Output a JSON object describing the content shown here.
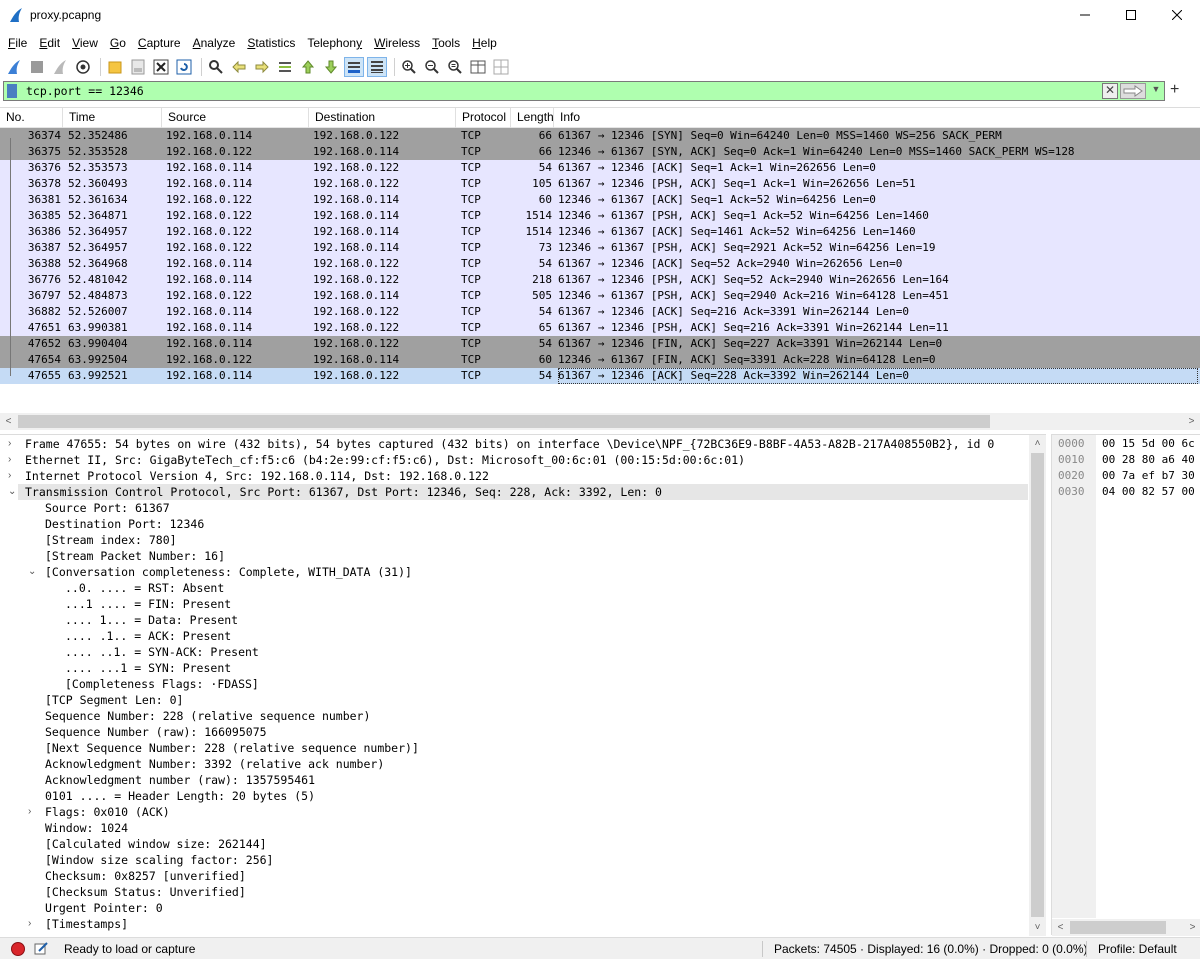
{
  "window": {
    "title": "proxy.pcapng"
  },
  "menu": [
    {
      "pre": "",
      "u": "F",
      "post": "ile"
    },
    {
      "pre": "",
      "u": "E",
      "post": "dit"
    },
    {
      "pre": "",
      "u": "V",
      "post": "iew"
    },
    {
      "pre": "",
      "u": "G",
      "post": "o"
    },
    {
      "pre": "",
      "u": "C",
      "post": "apture"
    },
    {
      "pre": "",
      "u": "A",
      "post": "nalyze"
    },
    {
      "pre": "",
      "u": "S",
      "post": "tatistics"
    },
    {
      "pre": "Telephon",
      "u": "y",
      "post": ""
    },
    {
      "pre": "",
      "u": "W",
      "post": "ireless"
    },
    {
      "pre": "",
      "u": "T",
      "post": "ools"
    },
    {
      "pre": "",
      "u": "H",
      "post": "elp"
    }
  ],
  "filter": {
    "text": "tcp.port == 12346",
    "plus": "+"
  },
  "packet_list": {
    "columns": [
      "No.",
      "Time",
      "Source",
      "Destination",
      "Protocol",
      "Length",
      "Info"
    ],
    "rows": [
      {
        "no": "36374",
        "time": "52.352486",
        "src": "192.168.0.114",
        "dst": "192.168.0.122",
        "proto": "TCP",
        "len": "66",
        "info": "61367 → 12346 [SYN] Seq=0 Win=64240 Len=0 MSS=1460 WS=256 SACK_PERM",
        "style": "dark"
      },
      {
        "no": "36375",
        "time": "52.353528",
        "src": "192.168.0.122",
        "dst": "192.168.0.114",
        "proto": "TCP",
        "len": "66",
        "info": "12346 → 61367 [SYN, ACK] Seq=0 Ack=1 Win=64240 Len=0 MSS=1460 SACK_PERM WS=128",
        "style": "dark"
      },
      {
        "no": "36376",
        "time": "52.353573",
        "src": "192.168.0.114",
        "dst": "192.168.0.122",
        "proto": "TCP",
        "len": "54",
        "info": "61367 → 12346 [ACK] Seq=1 Ack=1 Win=262656 Len=0",
        "style": "normal"
      },
      {
        "no": "36378",
        "time": "52.360493",
        "src": "192.168.0.114",
        "dst": "192.168.0.122",
        "proto": "TCP",
        "len": "105",
        "info": "61367 → 12346 [PSH, ACK] Seq=1 Ack=1 Win=262656 Len=51",
        "style": "normal"
      },
      {
        "no": "36381",
        "time": "52.361634",
        "src": "192.168.0.122",
        "dst": "192.168.0.114",
        "proto": "TCP",
        "len": "60",
        "info": "12346 → 61367 [ACK] Seq=1 Ack=52 Win=64256 Len=0",
        "style": "normal"
      },
      {
        "no": "36385",
        "time": "52.364871",
        "src": "192.168.0.122",
        "dst": "192.168.0.114",
        "proto": "TCP",
        "len": "1514",
        "info": "12346 → 61367 [PSH, ACK] Seq=1 Ack=52 Win=64256 Len=1460",
        "style": "normal"
      },
      {
        "no": "36386",
        "time": "52.364957",
        "src": "192.168.0.122",
        "dst": "192.168.0.114",
        "proto": "TCP",
        "len": "1514",
        "info": "12346 → 61367 [ACK] Seq=1461 Ack=52 Win=64256 Len=1460",
        "style": "normal"
      },
      {
        "no": "36387",
        "time": "52.364957",
        "src": "192.168.0.122",
        "dst": "192.168.0.114",
        "proto": "TCP",
        "len": "73",
        "info": "12346 → 61367 [PSH, ACK] Seq=2921 Ack=52 Win=64256 Len=19",
        "style": "normal"
      },
      {
        "no": "36388",
        "time": "52.364968",
        "src": "192.168.0.114",
        "dst": "192.168.0.122",
        "proto": "TCP",
        "len": "54",
        "info": "61367 → 12346 [ACK] Seq=52 Ack=2940 Win=262656 Len=0",
        "style": "normal"
      },
      {
        "no": "36776",
        "time": "52.481042",
        "src": "192.168.0.114",
        "dst": "192.168.0.122",
        "proto": "TCP",
        "len": "218",
        "info": "61367 → 12346 [PSH, ACK] Seq=52 Ack=2940 Win=262656 Len=164",
        "style": "normal"
      },
      {
        "no": "36797",
        "time": "52.484873",
        "src": "192.168.0.122",
        "dst": "192.168.0.114",
        "proto": "TCP",
        "len": "505",
        "info": "12346 → 61367 [PSH, ACK] Seq=2940 Ack=216 Win=64128 Len=451",
        "style": "normal"
      },
      {
        "no": "36882",
        "time": "52.526007",
        "src": "192.168.0.114",
        "dst": "192.168.0.122",
        "proto": "TCP",
        "len": "54",
        "info": "61367 → 12346 [ACK] Seq=216 Ack=3391 Win=262144 Len=0",
        "style": "normal"
      },
      {
        "no": "47651",
        "time": "63.990381",
        "src": "192.168.0.114",
        "dst": "192.168.0.122",
        "proto": "TCP",
        "len": "65",
        "info": "61367 → 12346 [PSH, ACK] Seq=216 Ack=3391 Win=262144 Len=11",
        "style": "normal"
      },
      {
        "no": "47652",
        "time": "63.990404",
        "src": "192.168.0.114",
        "dst": "192.168.0.122",
        "proto": "TCP",
        "len": "54",
        "info": "61367 → 12346 [FIN, ACK] Seq=227 Ack=3391 Win=262144 Len=0",
        "style": "dark"
      },
      {
        "no": "47654",
        "time": "63.992504",
        "src": "192.168.0.122",
        "dst": "192.168.0.114",
        "proto": "TCP",
        "len": "60",
        "info": "12346 → 61367 [FIN, ACK] Seq=3391 Ack=228 Win=64128 Len=0",
        "style": "dark"
      },
      {
        "no": "47655",
        "time": "63.992521",
        "src": "192.168.0.114",
        "dst": "192.168.0.122",
        "proto": "TCP",
        "len": "54",
        "info": "61367 → 12346 [ACK] Seq=228 Ack=3392 Win=262144 Len=0",
        "style": "selected"
      }
    ]
  },
  "details": [
    {
      "indent": 0,
      "twisty": "›",
      "text": "Frame 47655: 54 bytes on wire (432 bits), 54 bytes captured (432 bits) on interface \\Device\\NPF_{72BC36E9-B8BF-4A53-A82B-217A408550B2}, id 0"
    },
    {
      "indent": 0,
      "twisty": "›",
      "text": "Ethernet II, Src: GigaByteTech_cf:f5:c6 (b4:2e:99:cf:f5:c6), Dst: Microsoft_00:6c:01 (00:15:5d:00:6c:01)"
    },
    {
      "indent": 0,
      "twisty": "›",
      "text": "Internet Protocol Version 4, Src: 192.168.0.114, Dst: 192.168.0.122"
    },
    {
      "indent": 0,
      "twisty": "⌄",
      "text": "Transmission Control Protocol, Src Port: 61367, Dst Port: 12346, Seq: 228, Ack: 3392, Len: 0",
      "hl": true
    },
    {
      "indent": 1,
      "twisty": "",
      "text": "Source Port: 61367"
    },
    {
      "indent": 1,
      "twisty": "",
      "text": "Destination Port: 12346"
    },
    {
      "indent": 1,
      "twisty": "",
      "text": "[Stream index: 780]"
    },
    {
      "indent": 1,
      "twisty": "",
      "text": "[Stream Packet Number: 16]"
    },
    {
      "indent": 1,
      "twisty": "⌄",
      "text": "[Conversation completeness: Complete, WITH_DATA (31)]"
    },
    {
      "indent": 2,
      "twisty": "",
      "text": "..0. .... = RST: Absent"
    },
    {
      "indent": 2,
      "twisty": "",
      "text": "...1 .... = FIN: Present"
    },
    {
      "indent": 2,
      "twisty": "",
      "text": ".... 1... = Data: Present"
    },
    {
      "indent": 2,
      "twisty": "",
      "text": ".... .1.. = ACK: Present"
    },
    {
      "indent": 2,
      "twisty": "",
      "text": ".... ..1. = SYN-ACK: Present"
    },
    {
      "indent": 2,
      "twisty": "",
      "text": ".... ...1 = SYN: Present"
    },
    {
      "indent": 2,
      "twisty": "",
      "text": "[Completeness Flags: ·FDASS]"
    },
    {
      "indent": 1,
      "twisty": "",
      "text": "[TCP Segment Len: 0]"
    },
    {
      "indent": 1,
      "twisty": "",
      "text": "Sequence Number: 228    (relative sequence number)"
    },
    {
      "indent": 1,
      "twisty": "",
      "text": "Sequence Number (raw): 166095075"
    },
    {
      "indent": 1,
      "twisty": "",
      "text": "[Next Sequence Number: 228    (relative sequence number)]"
    },
    {
      "indent": 1,
      "twisty": "",
      "text": "Acknowledgment Number: 3392    (relative ack number)"
    },
    {
      "indent": 1,
      "twisty": "",
      "text": "Acknowledgment number (raw): 1357595461"
    },
    {
      "indent": 1,
      "twisty": "",
      "text": "0101 .... = Header Length: 20 bytes (5)"
    },
    {
      "indent": 1,
      "twisty": "›",
      "text": "Flags: 0x010 (ACK)"
    },
    {
      "indent": 1,
      "twisty": "",
      "text": "Window: 1024"
    },
    {
      "indent": 1,
      "twisty": "",
      "text": "[Calculated window size: 262144]"
    },
    {
      "indent": 1,
      "twisty": "",
      "text": "[Window size scaling factor: 256]"
    },
    {
      "indent": 1,
      "twisty": "",
      "text": "Checksum: 0x8257 [unverified]"
    },
    {
      "indent": 1,
      "twisty": "",
      "text": "[Checksum Status: Unverified]"
    },
    {
      "indent": 1,
      "twisty": "",
      "text": "Urgent Pointer: 0"
    },
    {
      "indent": 1,
      "twisty": "›",
      "text": "[Timestamps]"
    }
  ],
  "bytes": [
    {
      "offset": "0000",
      "hex": "00 15 5d 00 6c"
    },
    {
      "offset": "0010",
      "hex": "00 28 80 a6 40"
    },
    {
      "offset": "0020",
      "hex": "00 7a ef b7 30"
    },
    {
      "offset": "0030",
      "hex": "04 00 82 57 00"
    }
  ],
  "status": {
    "text": "Ready to load or capture",
    "stats": "Packets: 74505 · Displayed: 16 (0.0%) · Dropped: 0 (0.0%)",
    "profile": "Profile: Default"
  },
  "colors": {
    "filter_valid": "#afffaf",
    "row_normal": "#e7e6ff",
    "row_dark": "#a0a0a0",
    "row_selected": "#c5dbf5"
  }
}
